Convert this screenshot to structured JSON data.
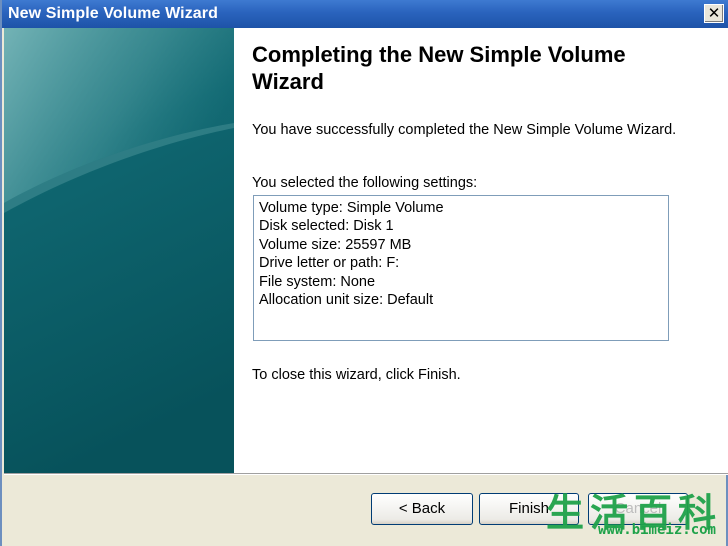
{
  "window": {
    "title": "New Simple Volume Wizard",
    "close_glyph": "✕"
  },
  "content": {
    "heading": "Completing the New Simple Volume Wizard",
    "intro": "You have successfully completed the New Simple Volume Wizard.",
    "list_caption": "You selected the following settings:",
    "settings": [
      "Volume type: Simple Volume",
      "Disk selected: Disk 1",
      "Volume size: 25597 MB",
      "Drive letter or path: F:",
      "File system: None",
      "Allocation unit size: Default"
    ],
    "close_hint": "To close this wizard, click Finish."
  },
  "buttons": {
    "back": "< Back",
    "finish": "Finish",
    "cancel": "Cancel"
  },
  "watermark": {
    "chars": "生活百科",
    "url": "www.bimeiz.com"
  },
  "colors": {
    "title_bar": "#2a63bd",
    "sidebar_dark": "#0d5a63",
    "sidebar_light": "#5fa7ab",
    "watermark": "#1fa24a"
  },
  "icons": {
    "close": "close-icon"
  }
}
